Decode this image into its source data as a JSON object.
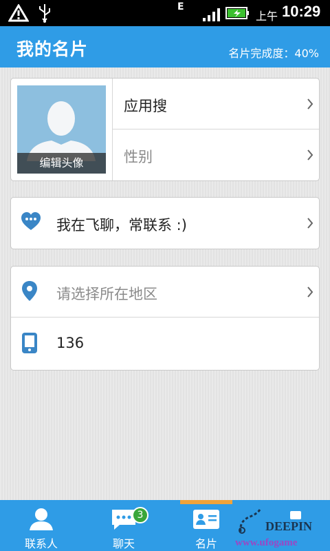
{
  "status_bar": {
    "network_type": "E",
    "am_pm": "上午",
    "time": "10:29"
  },
  "header": {
    "title": "我的名片",
    "completion_label": "名片完成度：40%"
  },
  "profile": {
    "avatar_caption": "编辑头像",
    "app_search": "应用搜",
    "gender_placeholder": "性别"
  },
  "chat": {
    "text": "我在飞聊，常联系 :)"
  },
  "location": {
    "placeholder": "请选择所在地区"
  },
  "phone": {
    "value": "136"
  },
  "bottom_nav": {
    "contacts": "联系人",
    "chat": "聊天",
    "chat_badge": "3",
    "card": "名片",
    "more": ""
  },
  "watermark": {
    "brand": "DEEPIN",
    "url": "www.ufogame"
  },
  "colors": {
    "accent": "#2f9ce6",
    "active_tab": "#f0a33a",
    "badge": "#3aa63a"
  }
}
